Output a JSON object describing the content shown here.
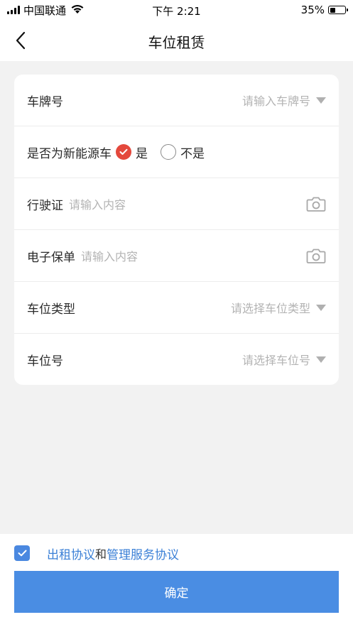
{
  "status_bar": {
    "carrier": "中国联通",
    "time": "下午 2:21",
    "battery_percent": "35%",
    "battery_level": 0.35
  },
  "nav": {
    "title": "车位租赁",
    "back_icon": "chevron-left-icon"
  },
  "form": {
    "plate": {
      "label": "车牌号",
      "placeholder": "请输入车牌号"
    },
    "new_energy": {
      "label": "是否为新能源车",
      "options": [
        {
          "label": "是",
          "checked": true
        },
        {
          "label": "不是",
          "checked": false
        }
      ]
    },
    "license": {
      "label": "行驶证",
      "placeholder": "请输入内容",
      "icon": "camera-icon"
    },
    "policy": {
      "label": "电子保单",
      "placeholder": "请输入内容",
      "icon": "camera-icon"
    },
    "spot_type": {
      "label": "车位类型",
      "placeholder": "请选择车位类型"
    },
    "spot_number": {
      "label": "车位号",
      "placeholder": "请选择车位号"
    }
  },
  "agreement": {
    "checked": true,
    "link1": "出租协议",
    "and": "和",
    "link2": "管理服务协议"
  },
  "confirm_label": "确定",
  "colors": {
    "accent_blue": "#4a8de3",
    "radio_red": "#e4483c",
    "link_blue": "#3a7fd6",
    "placeholder_gray": "#b3b3b3",
    "background": "#f2f2f2"
  }
}
